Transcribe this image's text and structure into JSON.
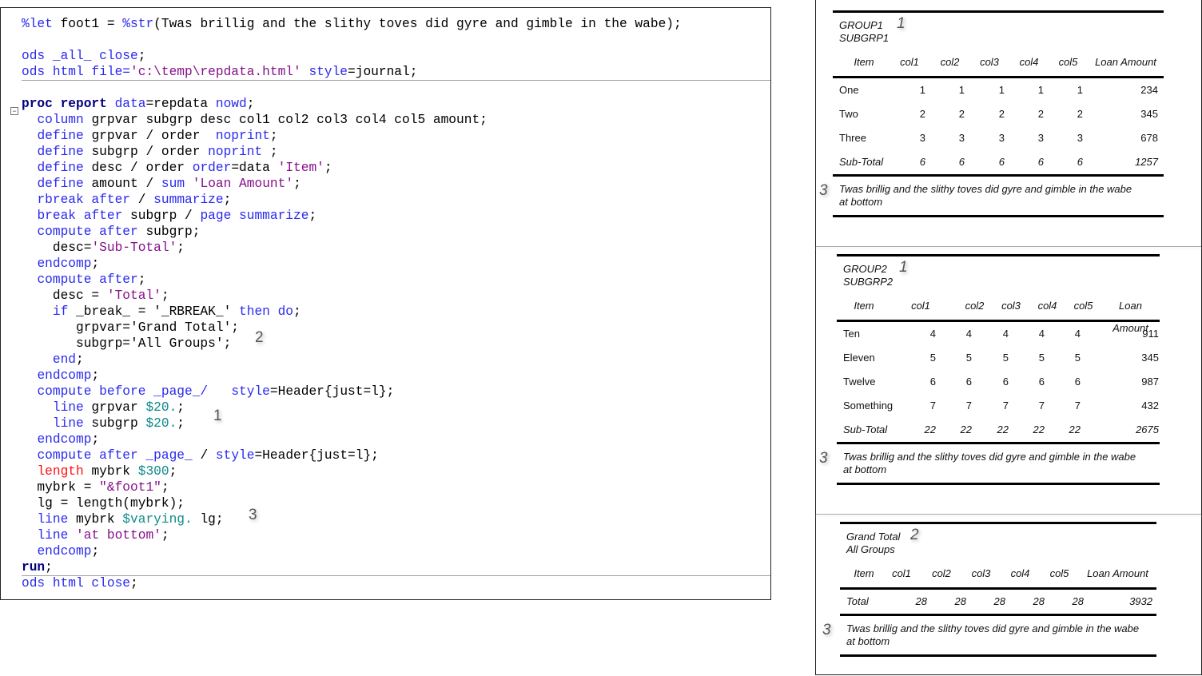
{
  "code": {
    "lines": [
      [
        [
          "k",
          "%let"
        ],
        [
          "t",
          " foot1 = "
        ],
        [
          "k",
          "%str"
        ],
        [
          "t",
          "(Twas brillig and the slithy toves did gyre and gimble in the wabe);"
        ]
      ],
      [],
      [
        [
          "k",
          "ods _all_ close"
        ],
        [
          "t",
          ";"
        ]
      ],
      [
        [
          "k",
          "ods html file="
        ],
        [
          "s",
          "'c:\\temp\\repdata.html'"
        ],
        [
          "t",
          " "
        ],
        [
          "k",
          "style"
        ],
        [
          "t",
          "=journal;"
        ]
      ],
      [],
      [
        [
          "b",
          "proc report"
        ],
        [
          "t",
          " "
        ],
        [
          "k",
          "data"
        ],
        [
          "t",
          "=repdata "
        ],
        [
          "k",
          "nowd"
        ],
        [
          "t",
          ";"
        ]
      ],
      [
        [
          "t",
          "  "
        ],
        [
          "k",
          "column"
        ],
        [
          "t",
          " grpvar subgrp desc col1 col2 col3 col4 col5 amount;"
        ]
      ],
      [
        [
          "t",
          "  "
        ],
        [
          "k",
          "define"
        ],
        [
          "t",
          " grpvar / order  "
        ],
        [
          "k",
          "noprint"
        ],
        [
          "t",
          ";"
        ]
      ],
      [
        [
          "t",
          "  "
        ],
        [
          "k",
          "define"
        ],
        [
          "t",
          " subgrp / order "
        ],
        [
          "k",
          "noprint"
        ],
        [
          "t",
          " ;"
        ]
      ],
      [
        [
          "t",
          "  "
        ],
        [
          "k",
          "define"
        ],
        [
          "t",
          " desc / order "
        ],
        [
          "k",
          "order"
        ],
        [
          "t",
          "=data "
        ],
        [
          "s",
          "'Item'"
        ],
        [
          "t",
          ";"
        ]
      ],
      [
        [
          "t",
          "  "
        ],
        [
          "k",
          "define"
        ],
        [
          "t",
          " amount / "
        ],
        [
          "k",
          "sum"
        ],
        [
          "t",
          " "
        ],
        [
          "s",
          "'Loan Amount'"
        ],
        [
          "t",
          ";"
        ]
      ],
      [
        [
          "t",
          "  "
        ],
        [
          "k",
          "rbreak after"
        ],
        [
          "t",
          " / "
        ],
        [
          "k",
          "summarize"
        ],
        [
          "t",
          ";"
        ]
      ],
      [
        [
          "t",
          "  "
        ],
        [
          "k",
          "break after"
        ],
        [
          "t",
          " subgrp / "
        ],
        [
          "k",
          "page summarize"
        ],
        [
          "t",
          ";"
        ]
      ],
      [
        [
          "t",
          "  "
        ],
        [
          "k",
          "compute after"
        ],
        [
          "t",
          " subgrp;"
        ]
      ],
      [
        [
          "t",
          "    desc="
        ],
        [
          "s",
          "'Sub-Total'"
        ],
        [
          "t",
          ";"
        ]
      ],
      [
        [
          "t",
          "  "
        ],
        [
          "k",
          "endcomp"
        ],
        [
          "t",
          ";"
        ]
      ],
      [
        [
          "t",
          "  "
        ],
        [
          "k",
          "compute after"
        ],
        [
          "t",
          ";"
        ]
      ],
      [
        [
          "t",
          "    desc = "
        ],
        [
          "s",
          "'Total'"
        ],
        [
          "t",
          ";"
        ]
      ],
      [
        [
          "t",
          "    "
        ],
        [
          "k",
          "if"
        ],
        [
          "t",
          " _break_ = '_RBREAK_' "
        ],
        [
          "k",
          "then do"
        ],
        [
          "t",
          ";"
        ]
      ],
      [
        [
          "t",
          "       grpvar='Grand Total';"
        ]
      ],
      [
        [
          "t",
          "       subgrp='All Groups';"
        ]
      ],
      [
        [
          "t",
          "    "
        ],
        [
          "k",
          "end"
        ],
        [
          "t",
          ";"
        ]
      ],
      [
        [
          "t",
          "  "
        ],
        [
          "k",
          "endcomp"
        ],
        [
          "t",
          ";"
        ]
      ],
      [
        [
          "t",
          "  "
        ],
        [
          "k",
          "compute before _page_/"
        ],
        [
          "t",
          "   "
        ],
        [
          "k",
          "style"
        ],
        [
          "t",
          "=Header{just=l};"
        ]
      ],
      [
        [
          "t",
          "    "
        ],
        [
          "k",
          "line"
        ],
        [
          "t",
          " grpvar "
        ],
        [
          "f",
          "$20."
        ],
        [
          "t",
          ";"
        ]
      ],
      [
        [
          "t",
          "    "
        ],
        [
          "k",
          "line"
        ],
        [
          "t",
          " subgrp "
        ],
        [
          "f",
          "$20."
        ],
        [
          "t",
          ";"
        ]
      ],
      [
        [
          "t",
          "  "
        ],
        [
          "k",
          "endcomp"
        ],
        [
          "t",
          ";"
        ]
      ],
      [
        [
          "t",
          "  "
        ],
        [
          "k",
          "compute after _page_"
        ],
        [
          "t",
          " / "
        ],
        [
          "k",
          "style"
        ],
        [
          "t",
          "=Header{just=l};"
        ]
      ],
      [
        [
          "t",
          "  "
        ],
        [
          "r",
          "length"
        ],
        [
          "t",
          " mybrk "
        ],
        [
          "f",
          "$300"
        ],
        [
          "t",
          ";"
        ]
      ],
      [
        [
          "t",
          "  mybrk = "
        ],
        [
          "s",
          "\"&foot1\""
        ],
        [
          "t",
          ";"
        ]
      ],
      [
        [
          "t",
          "  lg = length(mybrk);"
        ]
      ],
      [
        [
          "t",
          "  "
        ],
        [
          "k",
          "line"
        ],
        [
          "t",
          " mybrk "
        ],
        [
          "f",
          "$varying."
        ],
        [
          "t",
          " lg;"
        ]
      ],
      [
        [
          "t",
          "  "
        ],
        [
          "k",
          "line"
        ],
        [
          "t",
          " "
        ],
        [
          "s",
          "'at bottom'"
        ],
        [
          "t",
          ";"
        ]
      ],
      [
        [
          "t",
          "  "
        ],
        [
          "k",
          "endcomp"
        ],
        [
          "t",
          ";"
        ]
      ],
      [
        [
          "b",
          "run"
        ],
        [
          "t",
          ";"
        ]
      ],
      [
        [
          "k",
          "ods html close"
        ],
        [
          "t",
          ";"
        ]
      ]
    ],
    "markers": [
      "2",
      "1",
      "3"
    ]
  },
  "reports": [
    {
      "group": [
        "GROUP1",
        "SUBGRP1"
      ],
      "marker": "1",
      "columns": [
        "Item",
        "col1",
        "col2",
        "col3",
        "col4",
        "col5",
        "Loan Amount"
      ],
      "rows": [
        [
          "One",
          "1",
          "1",
          "1",
          "1",
          "1",
          "234"
        ],
        [
          "Two",
          "2",
          "2",
          "2",
          "2",
          "2",
          "345"
        ],
        [
          "Three",
          "3",
          "3",
          "3",
          "3",
          "3",
          "678"
        ]
      ],
      "summary": [
        "Sub-Total",
        "6",
        "6",
        "6",
        "6",
        "6",
        "1257"
      ],
      "footnote": [
        "Twas brillig and the slithy toves did gyre and gimble in the wabe",
        "at bottom"
      ],
      "foot_marker": "3"
    },
    {
      "group": [
        "GROUP2",
        "SUBGRP2"
      ],
      "marker": "1",
      "columns": [
        "Item",
        "col1",
        "col2",
        "col3",
        "col4",
        "col5",
        "Loan Amount"
      ],
      "rows": [
        [
          "Ten",
          "4",
          "4",
          "4",
          "4",
          "4",
          "911"
        ],
        [
          "Eleven",
          "5",
          "5",
          "5",
          "5",
          "5",
          "345"
        ],
        [
          "Twelve",
          "6",
          "6",
          "6",
          "6",
          "6",
          "987"
        ],
        [
          "Something",
          "7",
          "7",
          "7",
          "7",
          "7",
          "432"
        ]
      ],
      "summary": [
        "Sub-Total",
        "22",
        "22",
        "22",
        "22",
        "22",
        "2675"
      ],
      "footnote": [
        "Twas brillig and the slithy toves did gyre and gimble in the wabe",
        "at bottom"
      ],
      "foot_marker": "3"
    },
    {
      "group": [
        "Grand Total",
        "All Groups"
      ],
      "marker": "2",
      "columns": [
        "Item",
        "col1",
        "col2",
        "col3",
        "col4",
        "col5",
        "Loan Amount"
      ],
      "rows": [],
      "summary": [
        "Total",
        "28",
        "28",
        "28",
        "28",
        "28",
        "3932"
      ],
      "footnote": [
        "Twas brillig and the slithy toves did gyre and gimble in the wabe",
        "at bottom"
      ],
      "foot_marker": "3"
    }
  ]
}
